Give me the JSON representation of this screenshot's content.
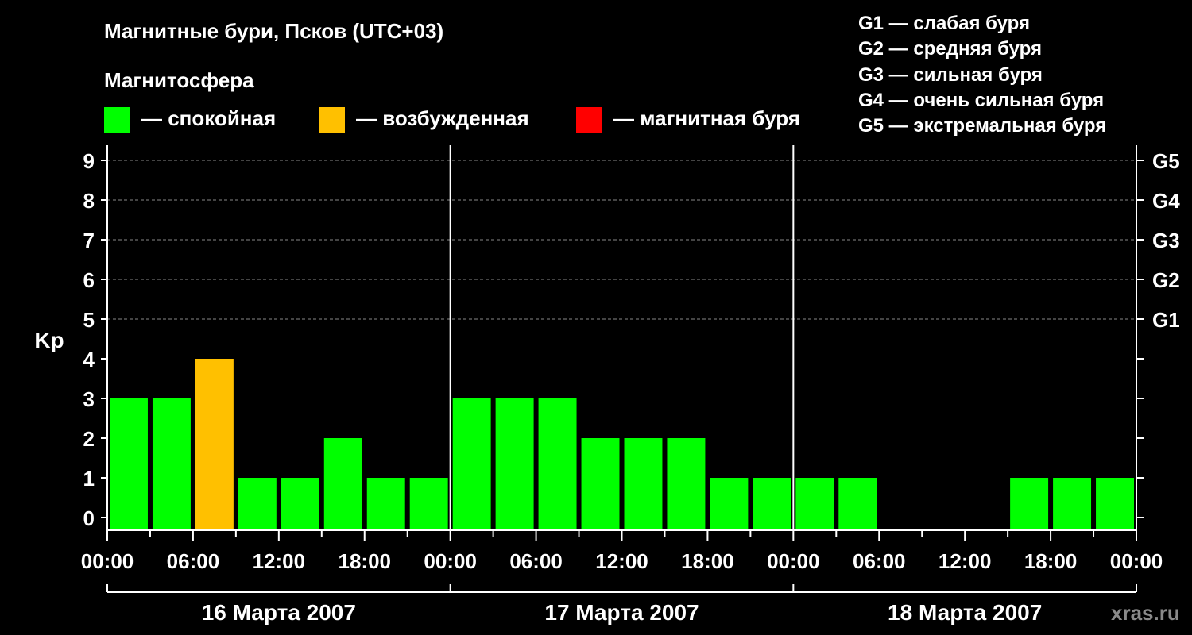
{
  "title": "Магнитные бури, Псков (UTC+03)",
  "subtitle": "Магнитосфера",
  "state_legend": [
    {
      "label": "— спокойная",
      "color": "#00ff00"
    },
    {
      "label": "— возбужденная",
      "color": "#ffc000"
    },
    {
      "label": "— магнитная буря",
      "color": "#ff0000"
    }
  ],
  "g_legend": [
    "G1 — слабая буря",
    "G2 — средняя буря",
    "G3 — сильная буря",
    "G4 — очень сильная буря",
    "G5 — экстремальная буря"
  ],
  "watermark": "xras.ru",
  "chart_data": {
    "type": "bar",
    "ylabel": "Kp",
    "ylim": [
      0,
      9
    ],
    "yticks": [
      "0",
      "1",
      "2",
      "3",
      "4",
      "5",
      "6",
      "7",
      "8",
      "9"
    ],
    "right_ticks": [
      {
        "value": 5,
        "label": "G1"
      },
      {
        "value": 6,
        "label": "G2"
      },
      {
        "value": 7,
        "label": "G3"
      },
      {
        "value": 8,
        "label": "G4"
      },
      {
        "value": 9,
        "label": "G5"
      }
    ],
    "grid": "dashed horizontal",
    "xtick_labels": [
      "00:00",
      "06:00",
      "12:00",
      "18:00",
      "00:00",
      "06:00",
      "12:00",
      "18:00",
      "00:00",
      "06:00",
      "12:00",
      "18:00",
      "00:00"
    ],
    "days": [
      "16 Марта 2007",
      "17 Марта 2007",
      "18 Марта 2007"
    ],
    "values": [
      3,
      3,
      4,
      1,
      1,
      2,
      1,
      1,
      3,
      3,
      3,
      2,
      2,
      2,
      1,
      1,
      1,
      1,
      0,
      0,
      0,
      1,
      1,
      1
    ],
    "colors": [
      "#00ff00",
      "#00ff00",
      "#ffc000",
      "#00ff00",
      "#00ff00",
      "#00ff00",
      "#00ff00",
      "#00ff00",
      "#00ff00",
      "#00ff00",
      "#00ff00",
      "#00ff00",
      "#00ff00",
      "#00ff00",
      "#00ff00",
      "#00ff00",
      "#00ff00",
      "#00ff00",
      "#00ff00",
      "#00ff00",
      "#00ff00",
      "#00ff00",
      "#00ff00",
      "#00ff00"
    ]
  }
}
